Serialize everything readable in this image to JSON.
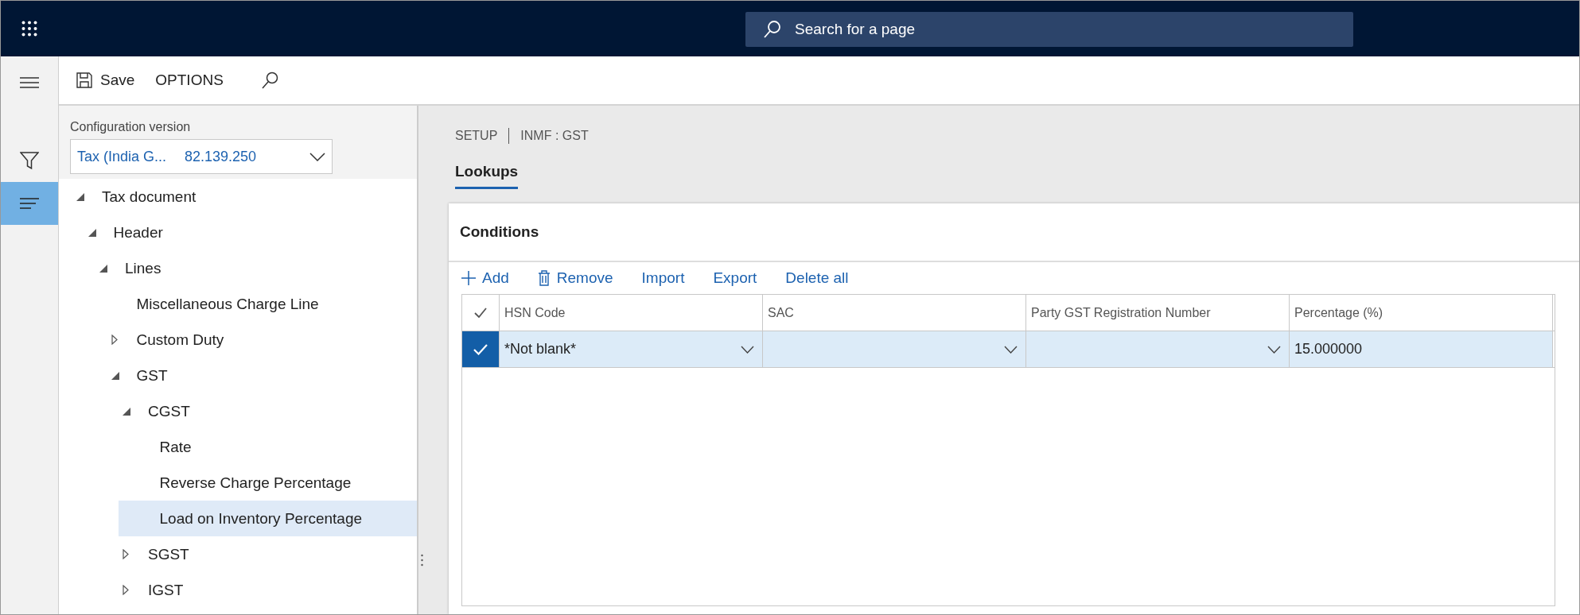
{
  "app_bar": {
    "search": {
      "placeholder": "Search for a page"
    }
  },
  "nav_rail": [
    {
      "kind": "menu",
      "selected": false
    },
    {
      "kind": "filter",
      "selected": false
    },
    {
      "kind": "list",
      "selected": true
    }
  ],
  "toolbar": [
    {
      "kind": "save",
      "label": "Save"
    },
    {
      "kind": "text",
      "label": "OPTIONS"
    },
    {
      "kind": "search"
    }
  ],
  "config_version": {
    "label": "Configuration version",
    "name": "Tax (India G...",
    "version": "82.139.250"
  },
  "tree": [
    {
      "label": "Tax document",
      "kind": "branch",
      "expanded": true,
      "selected": false,
      "children": [
        {
          "label": "Header",
          "kind": "branch",
          "expanded": true,
          "selected": false,
          "children": [
            {
              "label": "Lines",
              "kind": "branch",
              "expanded": true,
              "selected": false,
              "children": [
                {
                  "label": "Miscellaneous Charge Line",
                  "selected": false
                },
                {
                  "label": "Custom Duty",
                  "kind": "branch",
                  "expanded": false,
                  "selected": false
                },
                {
                  "label": "GST",
                  "kind": "branch",
                  "expanded": true,
                  "selected": false,
                  "children": [
                    {
                      "label": "CGST",
                      "kind": "branch",
                      "expanded": true,
                      "selected": false,
                      "children": [
                        {
                          "label": "Rate",
                          "selected": false
                        },
                        {
                          "label": "Reverse Charge Percentage",
                          "selected": false
                        },
                        {
                          "label": "Load on Inventory Percentage",
                          "selected": true
                        }
                      ]
                    },
                    {
                      "label": "SGST",
                      "kind": "branch",
                      "expanded": false,
                      "selected": false
                    },
                    {
                      "label": "IGST",
                      "kind": "branch",
                      "expanded": false,
                      "selected": false
                    }
                  ]
                }
              ]
            }
          ]
        }
      ]
    }
  ],
  "breadcrumb": [
    "SETUP",
    "INMF : GST"
  ],
  "tabs": [
    {
      "label": "Lookups",
      "selected": true
    }
  ],
  "section": {
    "title": "Conditions",
    "actions": [
      {
        "kind": "add",
        "label": "Add"
      },
      {
        "kind": "remove",
        "label": "Remove"
      },
      {
        "kind": "text",
        "label": "Import"
      },
      {
        "kind": "text",
        "label": "Export"
      },
      {
        "kind": "text",
        "label": "Delete all"
      }
    ],
    "table": {
      "columns": [
        {
          "label": "HSN Code",
          "kind": "lookup"
        },
        {
          "label": "SAC",
          "kind": "lookup"
        },
        {
          "label": "Party GST Registration Number",
          "kind": "lookup"
        },
        {
          "label": "Percentage (%)",
          "kind": "text"
        }
      ],
      "rows": [
        {
          "selected": true,
          "cells": [
            "*Not blank*",
            "",
            "",
            "15.000000"
          ]
        }
      ]
    }
  }
}
